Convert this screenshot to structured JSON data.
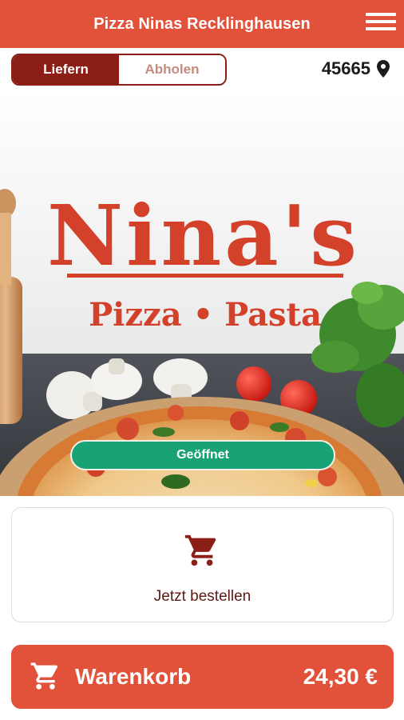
{
  "app": {
    "title": "Pizza Ninas Recklinghausen"
  },
  "delivery_toggle": {
    "options": [
      "Liefern",
      "Abholen"
    ],
    "selected": "Liefern"
  },
  "location": {
    "postal_code": "45665",
    "icon": "map-pin-icon"
  },
  "hero": {
    "logo_name": "Nina's",
    "logo_tagline": "Pizza • Pasta",
    "status": "Geöffnet"
  },
  "order_card": {
    "icon": "shopping-cart-icon",
    "label": "Jetzt bestellen"
  },
  "cart": {
    "icon": "shopping-cart-icon",
    "label": "Warenkorb",
    "total": "24,30 €"
  },
  "colors": {
    "brand_red": "#e2513a",
    "dark_red": "#8b1f18",
    "status_green": "#1aa277"
  }
}
